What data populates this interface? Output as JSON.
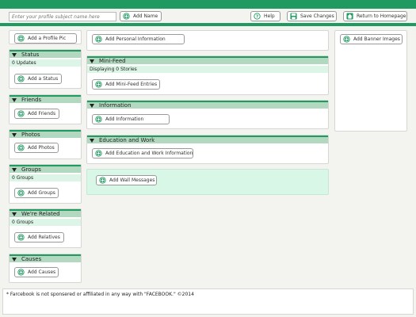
{
  "toolbar": {
    "name_placeholder": "Enter your profile subject name here",
    "add_name": "Add Name",
    "help": "Help",
    "save_changes": "Save Changes",
    "return_home": "Return to Homepage"
  },
  "left": {
    "add_profile_pic": "Add a Profile Pic",
    "status": {
      "title": "Status",
      "sub": "0 Updates",
      "button": "Add a Status"
    },
    "friends": {
      "title": "Friends",
      "button": "Add Friends"
    },
    "photos": {
      "title": "Photos",
      "button": "Add Photos"
    },
    "groups": {
      "title": "Groups",
      "sub": "0 Groups",
      "button": "Add Groups"
    },
    "related": {
      "title": "We're Related",
      "sub": "0 Groups",
      "button": "Add Relatives"
    },
    "causes": {
      "title": "Causes",
      "button": "Add Causes"
    }
  },
  "middle": {
    "add_personal_info": "Add Personal Information",
    "minifeed": {
      "title": "Mini-Feed",
      "sub": "Displaying 0 Stories",
      "button": "Add Mini-Feed Entries"
    },
    "information": {
      "title": "Information",
      "button": "Add Information"
    },
    "education": {
      "title": "Education and Work",
      "button": "Add Education and Work Information"
    },
    "wall": {
      "button": "Add Wall Messages"
    }
  },
  "right": {
    "add_banner": "Add Banner Images"
  },
  "footer": {
    "disclaimer": "* Farcebook is not sponsered or affiliated in any way with \"FACEBOOK.\" ©2014"
  },
  "colors": {
    "brand_green": "#1f9a61",
    "header_green": "#b2d9c0",
    "sub_green": "#ddf5e6"
  }
}
